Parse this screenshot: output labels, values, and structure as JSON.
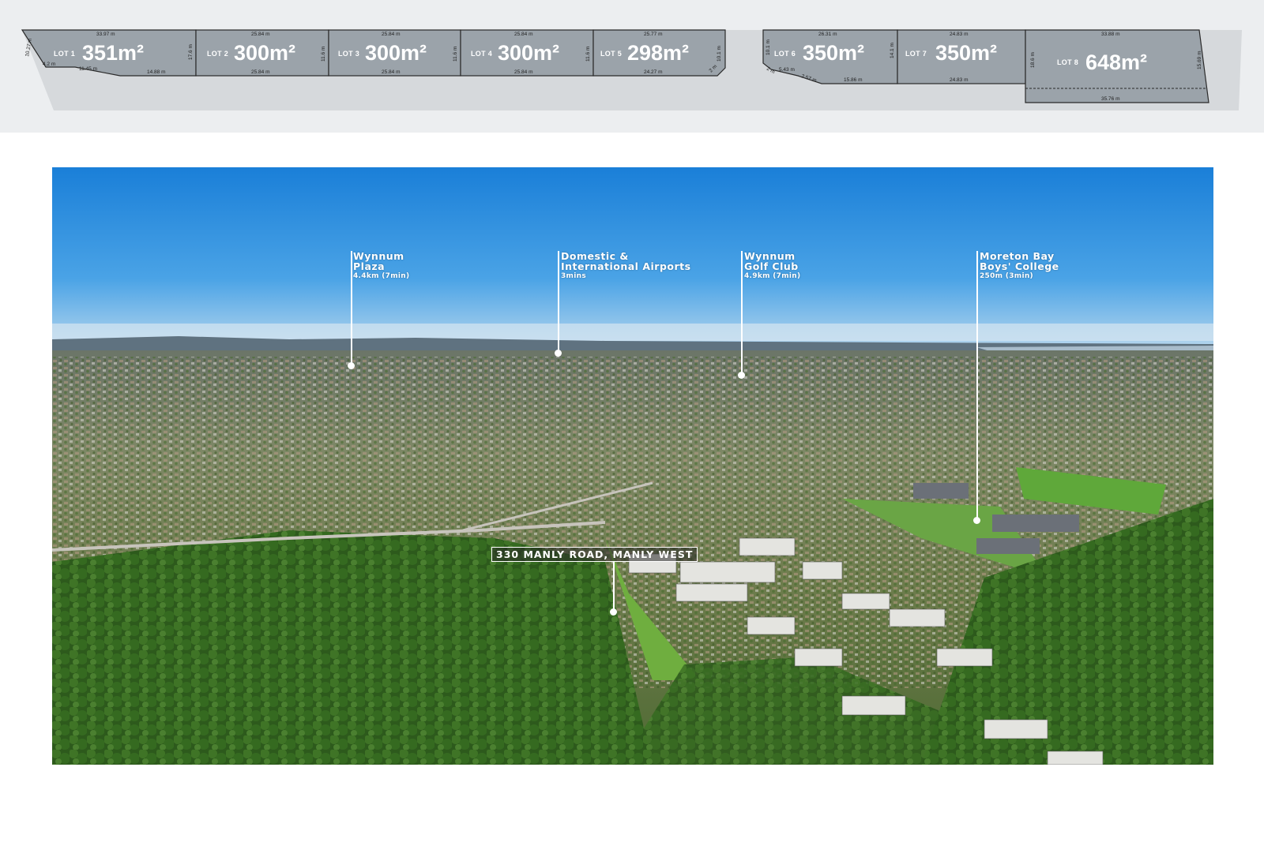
{
  "site_plan": {
    "lots": [
      {
        "label": "LOT 1",
        "area": "351m²",
        "dims": [
          "33.97 m",
          "10.27 m",
          "4.2 m",
          "11.45 m",
          "14.88 m",
          "17.6 m"
        ]
      },
      {
        "label": "LOT 2",
        "area": "300m²",
        "dims": [
          "25.84 m",
          "25.84 m",
          "11.6 m"
        ]
      },
      {
        "label": "LOT 3",
        "area": "300m²",
        "dims": [
          "25.84 m",
          "25.84 m",
          "11.6 m"
        ]
      },
      {
        "label": "LOT 4",
        "area": "300m²",
        "dims": [
          "25.84 m",
          "25.84 m",
          "11.6 m"
        ]
      },
      {
        "label": "LOT 5",
        "area": "298m²",
        "dims": [
          "25.77 m",
          "24.27 m",
          "10.1 m",
          "2 m"
        ]
      },
      {
        "label": "LOT 6",
        "area": "350m²",
        "dims": [
          "26.31 m",
          "10.1 m",
          "2 m",
          "5.43 m",
          "2.57 m",
          "15.86 m",
          "14.1 m"
        ]
      },
      {
        "label": "LOT 7",
        "area": "350m²",
        "dims": [
          "24.83 m",
          "24.83 m"
        ]
      },
      {
        "label": "LOT 8",
        "area": "648m²",
        "dims": [
          "33.88 m",
          "35.76 m",
          "18.6 m",
          "15.69 m"
        ]
      }
    ],
    "colors": {
      "lot_fill": "#9ba3aa",
      "band": "#eceef0",
      "shadow": "#d8dbde"
    }
  },
  "aerial": {
    "points_of_interest": [
      {
        "name_line1": "Wynnum",
        "name_line2": "Plaza",
        "distance": "4.4km (7min)"
      },
      {
        "name_line1": "Domestic &",
        "name_line2": "International Airports",
        "distance": "3mins"
      },
      {
        "name_line1": "Wynnum",
        "name_line2": "Golf Club",
        "distance": "4.9km (7min)"
      },
      {
        "name_line1": "Moreton Bay",
        "name_line2": "Boys' College",
        "distance": "250m (3min)"
      }
    ],
    "address": "330 MANLY ROAD, MANLY WEST",
    "colors": {
      "sky_top": "#1f86dd",
      "sky_horizon": "#bcd9ee",
      "suburb": "#7d8a62",
      "forest": "#2f5d1f"
    }
  }
}
